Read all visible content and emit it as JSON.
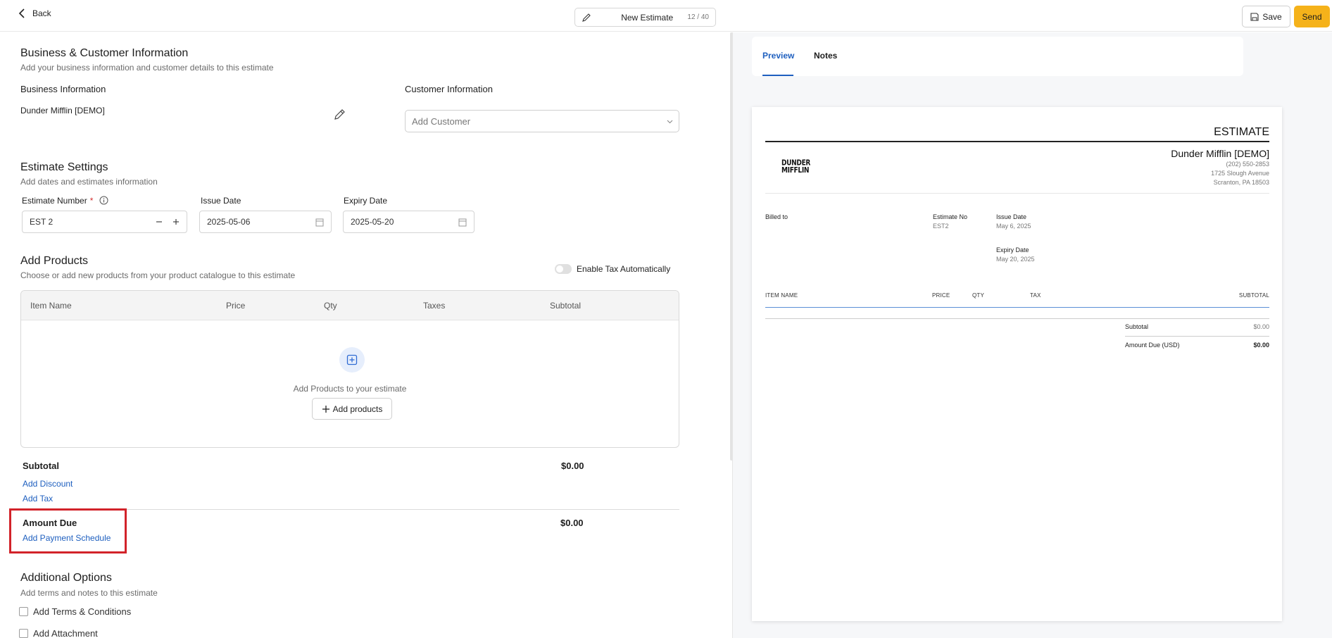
{
  "topbar": {
    "back_label": "Back",
    "title": "New Estimate",
    "title_counter": "12 / 40",
    "save_label": "Save",
    "send_label": "Send"
  },
  "business_customer": {
    "title": "Business & Customer Information",
    "subtitle": "Add your business information and customer details to this estimate",
    "business_label": "Business Information",
    "business_name": "Dunder Mifflin [DEMO]",
    "customer_label": "Customer Information",
    "customer_placeholder": "Add Customer"
  },
  "estimate_settings": {
    "title": "Estimate Settings",
    "subtitle": "Add dates and estimates information",
    "number_label": "Estimate Number",
    "required_mark": "*",
    "number_value": "EST 2",
    "issue_label": "Issue Date",
    "issue_value": "2025-05-06",
    "expiry_label": "Expiry Date",
    "expiry_value": "2025-05-20"
  },
  "products": {
    "title": "Add Products",
    "subtitle": "Choose or add new products from your product catalogue to this estimate",
    "tax_toggle_label": "Enable Tax Automatically",
    "tax_toggle_on": false,
    "columns": [
      "Item Name",
      "Price",
      "Qty",
      "Taxes",
      "Subtotal"
    ],
    "empty_text": "Add Products to your estimate",
    "add_button": "Add products"
  },
  "totals": {
    "subtotal_label": "Subtotal",
    "subtotal_value": "$0.00",
    "add_discount": "Add Discount",
    "add_tax": "Add Tax",
    "amount_due_label": "Amount Due",
    "amount_due_value": "$0.00",
    "add_payment_schedule": "Add Payment Schedule"
  },
  "additional": {
    "title": "Additional Options",
    "subtitle": "Add terms and notes to this estimate",
    "terms_label": "Add Terms & Conditions",
    "attachment_label": "Add Attachment"
  },
  "preview": {
    "tabs": [
      "Preview",
      "Notes"
    ],
    "active_tab": "Preview",
    "doc_title": "ESTIMATE",
    "logo_line1": "DUNDER",
    "logo_line2": "MIFFLIN",
    "company": "Dunder Mifflin [DEMO]",
    "phone": "(202) 550-2853",
    "address1": "1725 Slough Avenue",
    "address2": "Scranton, PA 18503",
    "billed_to": "Billed to",
    "estimate_no_label": "Estimate No",
    "estimate_no_value": "EST2",
    "issue_label": "Issue Date",
    "issue_value": "May 6, 2025",
    "expiry_label": "Expiry Date",
    "expiry_value": "May 20, 2025",
    "columns": [
      "ITEM NAME",
      "PRICE",
      "QTY",
      "TAX",
      "SUBTOTAL"
    ],
    "subtotal_label": "Subtotal",
    "subtotal_value": "$0.00",
    "amount_due_label": "Amount Due (USD)",
    "amount_due_value": "$0.00"
  },
  "colors": {
    "accent_blue": "#1e5fbf",
    "send_yellow": "#f5b21a",
    "highlight_red": "#d2232a"
  }
}
